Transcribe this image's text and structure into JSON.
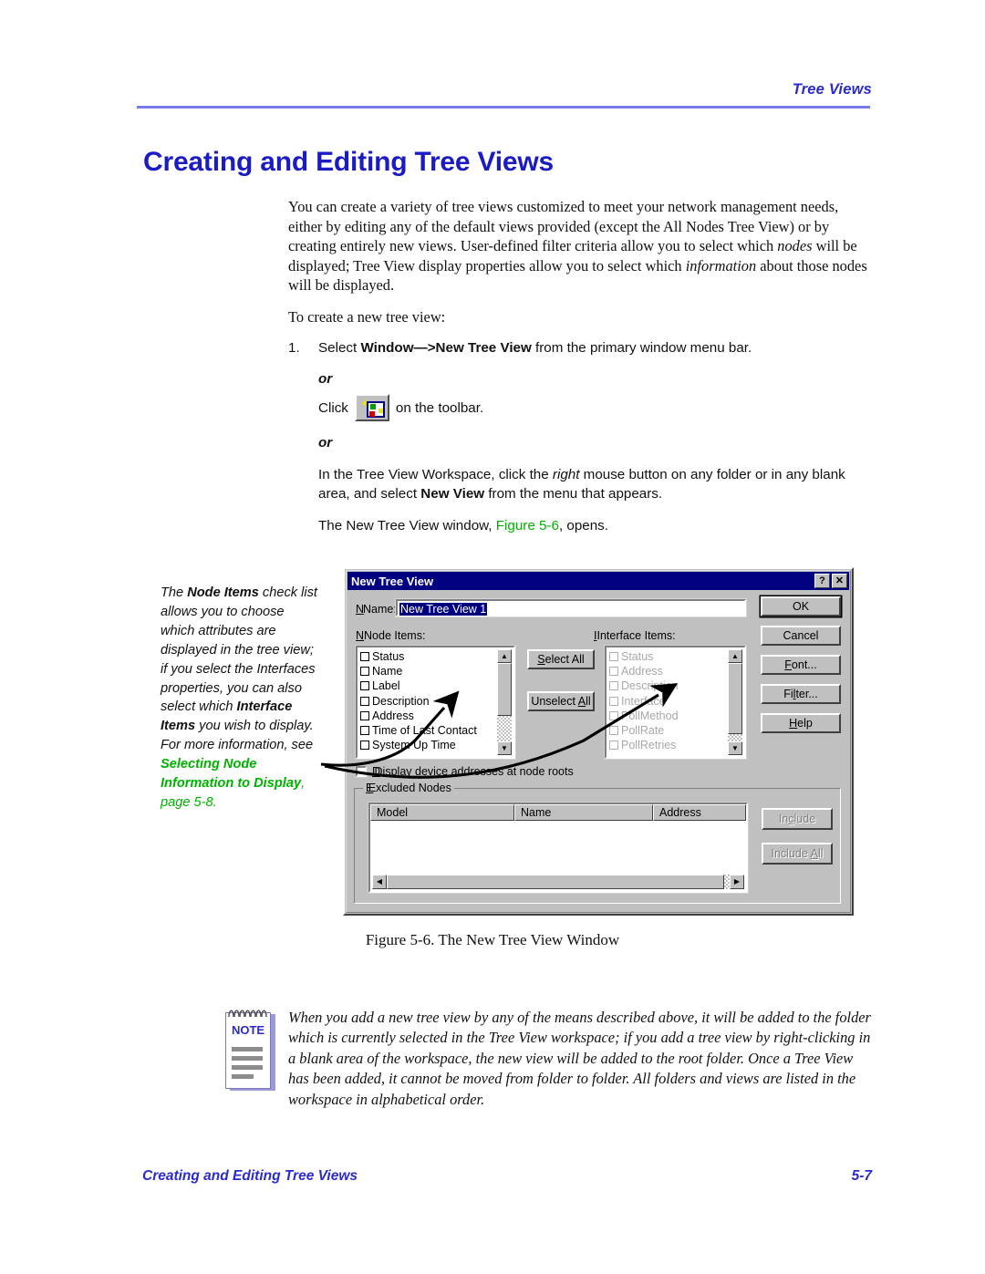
{
  "header": {
    "running_head": "Tree Views",
    "rule_color": "#7a7ae8"
  },
  "title": {
    "text": "Creating and Editing Tree Views",
    "color": "#1b1bc4"
  },
  "body": {
    "paragraph1_a": "You can create a variety of tree views customized to meet your network management needs, either by editing any of the default views provided (except the All Nodes Tree View) or by creating entirely new views. User-defined filter criteria allow you to select which ",
    "paragraph1_nodes": "nodes",
    "paragraph1_b": " will be displayed; Tree View display properties allow you to select which ",
    "paragraph1_info": "information",
    "paragraph1_c": " about those nodes will be displayed.",
    "paragraph2": "To create a new tree view:"
  },
  "steps": {
    "number": "1.",
    "step1_a": "Select ",
    "step1_bold": "Window—>New Tree View",
    "step1_b": " from the primary window menu bar.",
    "or1": "or",
    "click_label": "Click",
    "click_tail": "on the toolbar.",
    "or2": "or",
    "alt_a": "In the Tree View Workspace, click the ",
    "alt_italic": "right",
    "alt_b": " mouse button on any folder or in any blank area, and select ",
    "alt_bold": "New View",
    "alt_c": " from the menu that appears.",
    "result_a": "The New Tree View window, ",
    "result_link": "Figure 5-6",
    "result_b": ", opens.",
    "link_color": "#00b200"
  },
  "margin_note": {
    "t1": "The ",
    "b1": "Node Items",
    "t2": " check list allows you to choose which attributes are displayed in the tree view; if you select the Interfaces properties, you can also select which ",
    "b2": "Interface Items",
    "t3": " you wish to display. For more information, see ",
    "link_bold": "Selecting Node Information to Display",
    "link_tail": ", page 5-8.",
    "link_color": "#00b200"
  },
  "dialog": {
    "title": "New Tree View",
    "help_button": "?",
    "close_button": "✕",
    "name_label": "Name:",
    "name_value": "New Tree View 1",
    "node_items_label": "Node Items:",
    "interface_items_label": "Interface Items:",
    "node_items": [
      "Status",
      "Name",
      "Label",
      "Description",
      "Address",
      "Time of Last Contact",
      "System Up Time"
    ],
    "interface_items": [
      "Status",
      "Address",
      "Description",
      "Interface",
      "PollMethod",
      "PollRate",
      "PollRetries"
    ],
    "select_all": "Select All",
    "unselect_all": "Unselect All",
    "side_buttons": [
      "OK",
      "Cancel",
      "Font...",
      "Filter...",
      "Help"
    ],
    "display_addresses_label": "Display device addresses at node roots",
    "excluded_nodes_label": "Excluded Nodes",
    "excluded_columns": [
      "Model",
      "Name",
      "Address"
    ],
    "include_button": "Include",
    "include_all_button": "Include All",
    "titlebar_color": "#000080",
    "face_color": "#c0c0c0"
  },
  "figure_caption": "Figure 5-6.  The New Tree View Window",
  "note": {
    "icon_label": "NOTE",
    "text": "When you add a new tree view by any of the means described above, it will be added to the folder which is currently selected in the Tree View workspace; if you add a tree view by right-clicking in a blank area of the workspace, the new view will be added to the root folder. Once a Tree View has been added, it cannot be moved from folder to folder. All folders and views are listed in the workspace in alphabetical order."
  },
  "footer": {
    "left": "Creating and Editing Tree Views",
    "right": "5-7"
  }
}
